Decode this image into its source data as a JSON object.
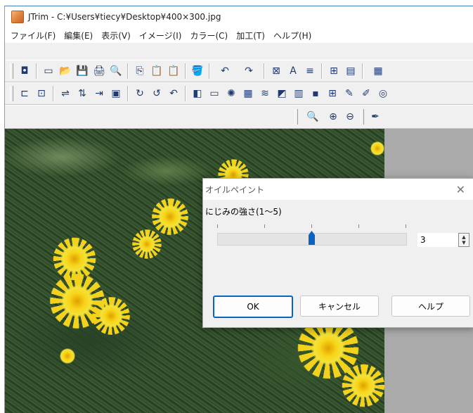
{
  "window": {
    "title": "JTrim - C:¥Users¥tiecy¥Desktop¥400×300.jpg"
  },
  "menubar": {
    "items": [
      "ファイル(F)",
      "編集(E)",
      "表示(V)",
      "イメージ(I)",
      "カラー(C)",
      "加工(T)",
      "ヘルプ(H)"
    ]
  },
  "toolbar1": {
    "icons": [
      "◘",
      "▭",
      "📂",
      "💾",
      "🖨",
      "🔍",
      "⎘",
      "📋",
      "📋",
      "🪣",
      "↶",
      "↷",
      "⊠",
      "A",
      "≡",
      "⊞",
      "▤",
      "▦"
    ]
  },
  "toolbar2": {
    "icons": [
      "⊏",
      "⊡",
      "⇌",
      "⇅",
      "⇥",
      "▣",
      "↻",
      "↺",
      "↶",
      "◧",
      "▭",
      "✺",
      "▦",
      "≋",
      "◩",
      "▥",
      "▪",
      "⊞",
      "✎",
      "✐",
      "◎"
    ]
  },
  "toolbar3": {
    "icons": [
      "🔍",
      "⊕",
      "⊖",
      "✒"
    ]
  },
  "dialog": {
    "title": "オイルペイント",
    "close": "✕",
    "label": "にじみの強さ(1〜5)",
    "slider": {
      "min": 1,
      "max": 5,
      "value": 3
    },
    "spin_value": "3",
    "ok": "OK",
    "cancel": "キャンセル",
    "help": "ヘルプ"
  },
  "colors": {
    "accent": "#0a63c2",
    "canvas_bg": "#aaaaaa",
    "flower": "#f2d21c"
  }
}
